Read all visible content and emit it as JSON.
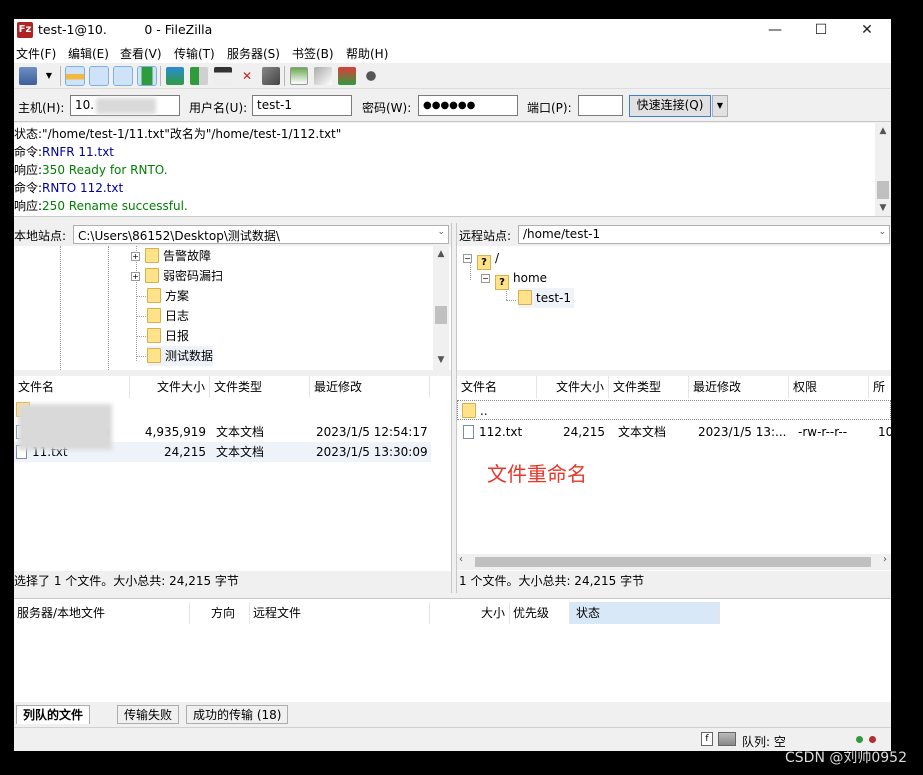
{
  "window": {
    "title": "test-1@10.   0 - FileZilla",
    "app_icon": "Fz",
    "controls": {
      "minimize": "—",
      "maximize": "☐",
      "close": "✕"
    }
  },
  "menu": [
    "文件(F)",
    "编辑(E)",
    "查看(V)",
    "传输(T)",
    "服务器(S)",
    "书签(B)",
    "帮助(H)"
  ],
  "quickconnect": {
    "host_label": "主机(H):",
    "host_value": "10.",
    "user_label": "用户名(U):",
    "user_value": "test-1",
    "pass_label": "密码(W):",
    "pass_value": "●●●●●●",
    "port_label": "端口(P):",
    "port_value": "",
    "connect_button": "快速连接(Q)"
  },
  "log": [
    {
      "prefix": "状态:",
      "text": "\"/home/test-1/11.txt\"改名为\"/home/test-1/112.txt\"",
      "kind": "status"
    },
    {
      "prefix": "命令:",
      "text": "RNFR 11.txt",
      "kind": "cmd"
    },
    {
      "prefix": "响应:",
      "text": "350 Ready for RNTO.",
      "kind": "resp"
    },
    {
      "prefix": "命令:",
      "text": "RNTO 112.txt",
      "kind": "cmd"
    },
    {
      "prefix": "响应:",
      "text": "250 Rename successful.",
      "kind": "resp"
    }
  ],
  "local": {
    "site_label": "本地站点:",
    "path": "C:\\Users\\86152\\Desktop\\测试数据\\",
    "tree": [
      {
        "label": "告警故障",
        "expandable": true
      },
      {
        "label": "弱密码漏扫",
        "expandable": true
      },
      {
        "label": "方案",
        "expandable": false
      },
      {
        "label": "日志",
        "expandable": false
      },
      {
        "label": "日报",
        "expandable": false
      },
      {
        "label": "测试数据",
        "expandable": false
      }
    ],
    "columns": [
      "文件名",
      "文件大小",
      "文件类型",
      "最近修改"
    ],
    "files": [
      {
        "name": "",
        "size": "",
        "type": "",
        "modified": "",
        "folder": true
      },
      {
        "name": "g",
        "size": "4,935,919",
        "type": "文本文档",
        "modified": "2023/1/5 12:54:17",
        "folder": false
      },
      {
        "name": "11.txt",
        "size": "24,215",
        "type": "文本文档",
        "modified": "2023/1/5 13:30:09",
        "folder": false
      }
    ],
    "status": "选择了 1 个文件。大小总共: 24,215 字节"
  },
  "remote": {
    "site_label": "远程站点:",
    "path": "/home/test-1",
    "tree": [
      {
        "label": "/"
      },
      {
        "label": "home"
      },
      {
        "label": "test-1"
      }
    ],
    "columns": [
      "文件名",
      "文件大小",
      "文件类型",
      "最近修改",
      "权限",
      "所"
    ],
    "files": [
      {
        "name": "..",
        "size": "",
        "type": "",
        "modified": "",
        "perms": "",
        "owner": "",
        "folder": true
      },
      {
        "name": "112.txt",
        "size": "24,215",
        "type": "文本文档",
        "modified": "2023/1/5 13:...",
        "perms": "-rw-r--r--",
        "owner": "10",
        "folder": false
      }
    ],
    "status": "1 个文件。大小总共: 24,215 字节"
  },
  "annotation": "文件重命名",
  "queue": {
    "columns": [
      "服务器/本地文件",
      "方向",
      "远程文件",
      "大小",
      "优先级",
      "状态"
    ]
  },
  "tabs": [
    "列队的文件",
    "传输失败",
    "成功的传输 (18)"
  ],
  "footer": {
    "queue_label": "队列: 空"
  },
  "watermark": "CSDN @刘帅0952",
  "colors": {
    "accent": "#3c7fd6",
    "annotation": "#e8372a",
    "cmd": "#0000a0",
    "resp": "#008000"
  }
}
